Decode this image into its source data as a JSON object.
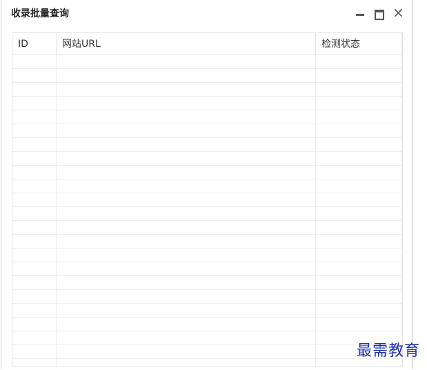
{
  "window": {
    "title": "收录批量查询",
    "minimize_icon": "minimize-icon",
    "maximize_icon": "maximize-icon",
    "close_icon": "close-icon",
    "close_glyph": "×"
  },
  "table": {
    "columns": [
      "ID",
      "网站URL",
      "检测状态"
    ],
    "rows": []
  },
  "watermark": "最需教育"
}
